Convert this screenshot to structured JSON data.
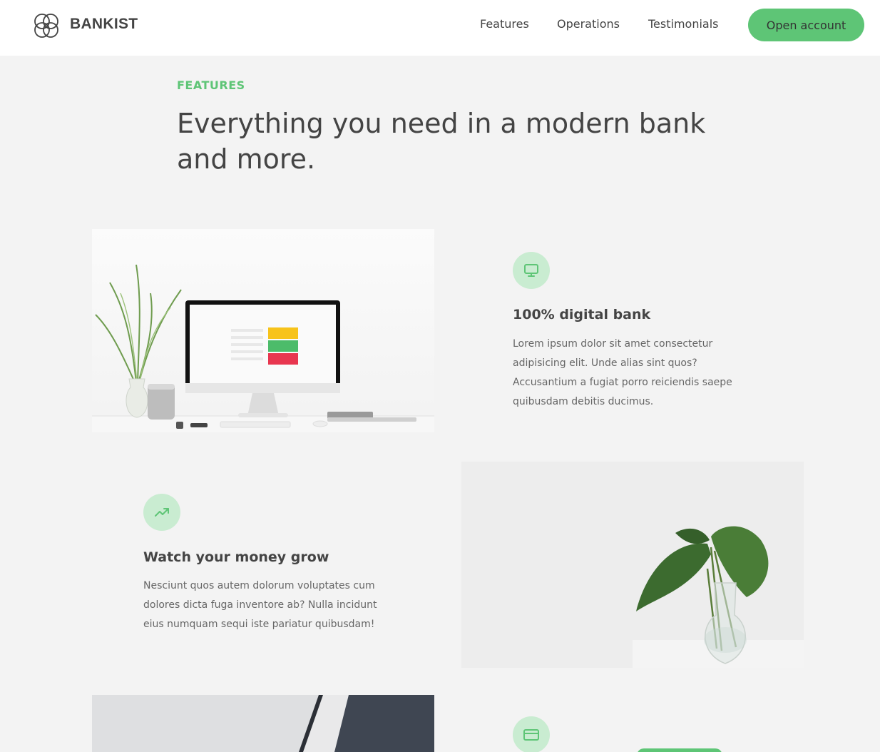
{
  "nav": {
    "brand": "BANKIST",
    "links": [
      "Features",
      "Operations",
      "Testimonials"
    ],
    "cta": "Open account",
    "accent": "#5ec576"
  },
  "section": {
    "label": "FEATURES",
    "title": "Everything you need in a modern bank and more."
  },
  "features": [
    {
      "icon": "monitor-icon",
      "title": "100% digital bank",
      "text": "Lorem ipsum dolor sit amet consectetur adipisicing elit. Unde alias sint quos? Accusantium a fugiat porro reiciendis saepe quibusdam debitis ducimus."
    },
    {
      "icon": "trending-up-icon",
      "title": "Watch your money grow",
      "text": "Nesciunt quos autem dolorum voluptates cum dolores dicta fuga inventore ab? Nulla incidunt eius numquam sequi iste pariatur quibusdam!"
    },
    {
      "icon": "credit-card-icon"
    }
  ]
}
